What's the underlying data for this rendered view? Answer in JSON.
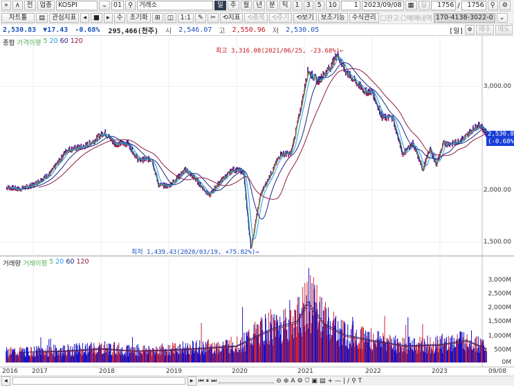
{
  "toolbar1": {
    "code_label": "업종",
    "code": "KOSPI",
    "sub": "01",
    "market": "거래소",
    "periods": [
      "일",
      "주",
      "월",
      "년",
      "분",
      "틱"
    ],
    "minutes": [
      "1",
      "3",
      "5",
      "10"
    ],
    "n": "1",
    "date": "2023/09/08",
    "count1": "1756",
    "sep": "/",
    "count2": "1756",
    "back": "전"
  },
  "toolbar2": {
    "chart_tool": "차트툴",
    "watch": "관심지표",
    "su": "수",
    "reset": "초기화",
    "one": "1:1",
    "indicator": "지표",
    "stock": "종목",
    "period": "주기",
    "view": "보기",
    "assist": "보조기능",
    "formula": "수식관리",
    "balance": "잔고",
    "trades": "매매내역",
    "account": "170-4138-3022-0"
  },
  "info": {
    "price": "2,530.83",
    "change": "▼17.43",
    "pct": "-0.68%",
    "volume": "295,466(천주)",
    "open_label": "시",
    "open": "2,546.07",
    "high_label": "고",
    "high": "2,550.96",
    "low_label": "저",
    "low": "2,530.05",
    "period": "[일]",
    "buy": "매수",
    "sell": "매도"
  },
  "price_panel": {
    "legend": [
      "종합",
      "가격이평",
      "5",
      "20",
      "60",
      "120"
    ],
    "high_note": "최고 3,316.08(2021/06/25, -23.68%)←",
    "low_note": "최저 1,439.43(2020/03/19, +75.82%)→",
    "current": "2,530.83",
    "current_pct": "(-0.68%)",
    "y_labels": [
      "3,000.00",
      "2,000.00",
      "1,500.00"
    ]
  },
  "volume_panel": {
    "legend": [
      "거래량",
      "거래이평",
      "5",
      "20",
      "60",
      "120"
    ],
    "y_labels": [
      "3,000M",
      "2,500M",
      "2,000M",
      "1,500M",
      "1,000M",
      "500M",
      "0M"
    ]
  },
  "x_labels": [
    "2016",
    "2017",
    "2018",
    "2019",
    "2020",
    "2021",
    "2022",
    "2023",
    "09/08"
  ],
  "colors": {
    "up": "#d0202a",
    "down": "#1010c8",
    "ma5": "#4caf50",
    "ma20": "#2196f3",
    "ma60": "#1a237e",
    "ma120": "#8b1a3a"
  },
  "chart_data": {
    "type": "line",
    "price": [
      [
        2016.6,
        2030
      ],
      [
        2016.8,
        2010
      ],
      [
        2017.0,
        2050
      ],
      [
        2017.25,
        2160
      ],
      [
        2017.5,
        2390
      ],
      [
        2017.75,
        2420
      ],
      [
        2017.9,
        2480
      ],
      [
        2018.05,
        2560
      ],
      [
        2018.2,
        2450
      ],
      [
        2018.4,
        2450
      ],
      [
        2018.55,
        2290
      ],
      [
        2018.75,
        2300
      ],
      [
        2018.85,
        2050
      ],
      [
        2019.0,
        2040
      ],
      [
        2019.25,
        2200
      ],
      [
        2019.4,
        2100
      ],
      [
        2019.6,
        1950
      ],
      [
        2019.75,
        2080
      ],
      [
        2019.95,
        2200
      ],
      [
        2020.1,
        2180
      ],
      [
        2020.21,
        1439
      ],
      [
        2020.35,
        1950
      ],
      [
        2020.5,
        2150
      ],
      [
        2020.65,
        2350
      ],
      [
        2020.8,
        2350
      ],
      [
        2020.95,
        2800
      ],
      [
        2021.05,
        3150
      ],
      [
        2021.2,
        3050
      ],
      [
        2021.4,
        3200
      ],
      [
        2021.48,
        3316
      ],
      [
        2021.6,
        3150
      ],
      [
        2021.75,
        3050
      ],
      [
        2021.9,
        2950
      ],
      [
        2022.0,
        2950
      ],
      [
        2022.15,
        2700
      ],
      [
        2022.3,
        2700
      ],
      [
        2022.45,
        2350
      ],
      [
        2022.6,
        2450
      ],
      [
        2022.75,
        2200
      ],
      [
        2022.85,
        2400
      ],
      [
        2022.95,
        2250
      ],
      [
        2023.05,
        2450
      ],
      [
        2023.2,
        2450
      ],
      [
        2023.35,
        2500
      ],
      [
        2023.5,
        2600
      ],
      [
        2023.6,
        2630
      ],
      [
        2023.69,
        2530
      ]
    ],
    "volume": [
      [
        2016.6,
        350
      ],
      [
        2017.0,
        380
      ],
      [
        2017.5,
        420
      ],
      [
        2018.0,
        500
      ],
      [
        2018.5,
        420
      ],
      [
        2019.0,
        450
      ],
      [
        2019.5,
        520
      ],
      [
        2020.0,
        600
      ],
      [
        2020.25,
        900
      ],
      [
        2020.5,
        1200
      ],
      [
        2020.9,
        1500
      ],
      [
        2021.05,
        2200
      ],
      [
        2021.3,
        1400
      ],
      [
        2021.6,
        1000
      ],
      [
        2022.0,
        800
      ],
      [
        2022.5,
        600
      ],
      [
        2023.0,
        650
      ],
      [
        2023.4,
        800
      ],
      [
        2023.69,
        500
      ]
    ]
  }
}
